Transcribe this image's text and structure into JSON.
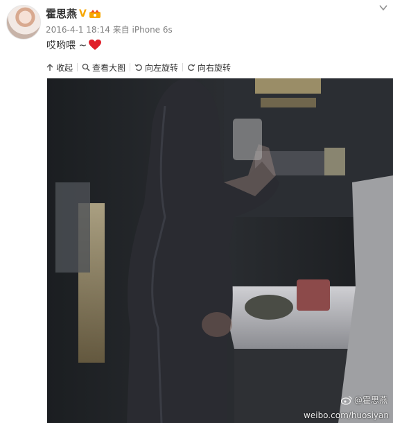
{
  "post": {
    "username": "霍思燕",
    "verified_badge": "V",
    "timestamp": "2016-4-1 18:14",
    "source_prefix": "来自",
    "source_device": "iPhone 6s",
    "text": "哎哟喂 ~"
  },
  "toolbar": {
    "collapse_label": "收起",
    "view_large_label": "查看大图",
    "rotate_left_label": "向左旋转",
    "rotate_right_label": "向右旋转"
  },
  "photo": {
    "watermark_name": "@霍思燕",
    "watermark_url": "weibo.com/huosiyan"
  },
  "colors": {
    "verified": "#f7a600",
    "heart": "#e0202a",
    "meta_text": "#808080"
  },
  "icons": [
    "chevron-down-icon",
    "crown-icon",
    "heart-icon",
    "collapse-icon",
    "magnifier-icon",
    "rotate-left-icon",
    "rotate-right-icon",
    "weibo-logo-icon"
  ]
}
